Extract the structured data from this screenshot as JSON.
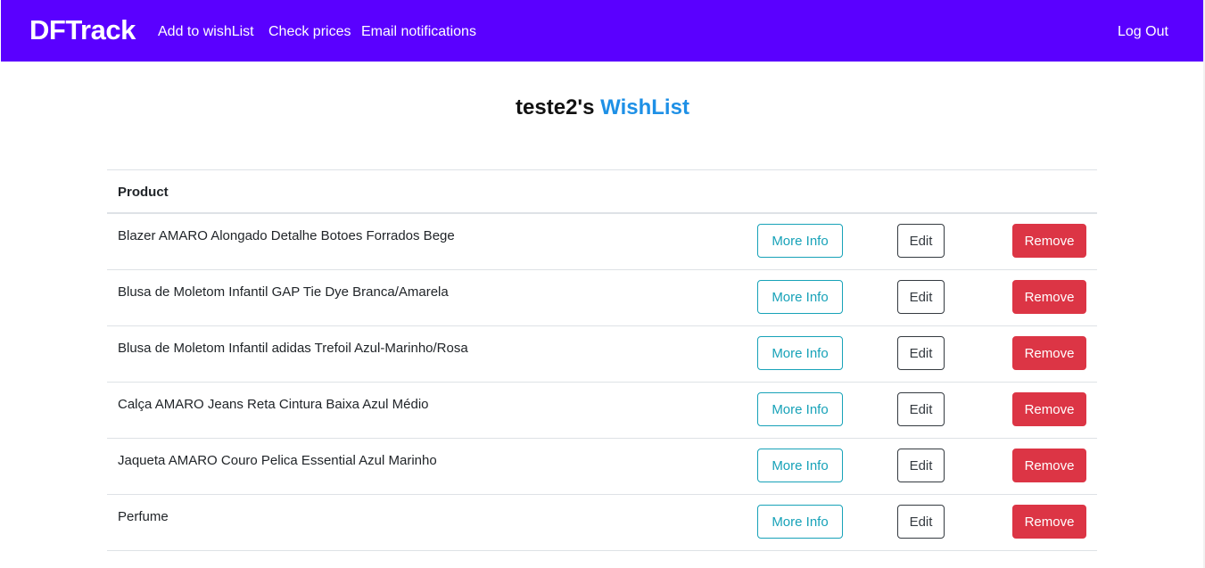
{
  "navbar": {
    "brand": "DFTrack",
    "links": [
      "Add to wishList",
      "Check prices",
      "Email notifications"
    ],
    "logout": "Log Out",
    "bg_color": "#5a00ff"
  },
  "page": {
    "owner": "teste2's",
    "title_accent": "WishList",
    "accent_color": "#1e90e6"
  },
  "table": {
    "header_product": "Product",
    "more_info_label": "More Info",
    "edit_label": "Edit",
    "remove_label": "Remove",
    "rows": [
      "Blazer AMARO Alongado Detalhe Botoes Forrados Bege",
      "Blusa de Moletom Infantil GAP Tie Dye Branca/Amarela",
      "Blusa de Moletom Infantil adidas Trefoil Azul-Marinho/Rosa",
      "Calça AMARO Jeans Reta Cintura Baixa Azul Médio",
      "Jaqueta AMARO Couro Pelica Essential Azul Marinho",
      "Perfume"
    ]
  }
}
